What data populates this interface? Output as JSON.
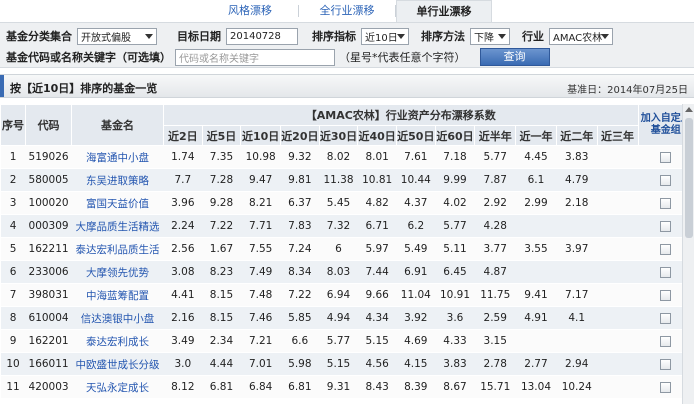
{
  "tabs": [
    {
      "label": "风格漂移",
      "active": false
    },
    {
      "label": "全行业漂移",
      "active": false
    },
    {
      "label": "单行业漂移",
      "active": true
    }
  ],
  "filter": {
    "category_label": "基金分类集合",
    "category_value": "开放式偏股",
    "date_label": "目标日期",
    "date_value": "20140728",
    "sort_metric_label": "排序指标",
    "sort_metric_value": "近10日",
    "sort_method_label": "排序方法",
    "sort_method_value": "下降",
    "industry_label": "行业",
    "industry_value": "AMAC农林",
    "keyword_label": "基金代码或名称关键字（可选填）",
    "keyword_placeholder": "代码或名称关键字",
    "hint": "（星号*代表任意个字符）",
    "query_button": "查询"
  },
  "section": {
    "title": "按【近10日】排序的基金一览",
    "base_date": "基准日：2014年07月25日"
  },
  "table": {
    "header_seq": "序号",
    "header_code": "代码",
    "header_name": "基金名",
    "header_group": "【AMAC农林】行业资产分布漂移系数",
    "header_add": "加入自定义基金组",
    "periods": [
      "近2日",
      "近5日",
      "近10日",
      "近20日",
      "近30日",
      "近40日",
      "近50日",
      "近60日",
      "近半年",
      "近一年",
      "近二年",
      "近三年"
    ],
    "rows": [
      {
        "seq": "1",
        "code": "519026",
        "name": "海富通中小盘",
        "v": [
          "1.74",
          "7.35",
          "10.98",
          "9.32",
          "8.02",
          "8.01",
          "7.61",
          "7.18",
          "5.77",
          "4.45",
          "3.83",
          ""
        ]
      },
      {
        "seq": "2",
        "code": "580005",
        "name": "东吴进取策略",
        "v": [
          "7.7",
          "7.28",
          "9.47",
          "9.81",
          "11.38",
          "10.81",
          "10.44",
          "9.99",
          "7.87",
          "6.1",
          "4.79",
          ""
        ]
      },
      {
        "seq": "3",
        "code": "100020",
        "name": "富国天益价值",
        "v": [
          "3.96",
          "9.28",
          "8.21",
          "6.37",
          "5.45",
          "4.82",
          "4.37",
          "4.02",
          "2.92",
          "2.99",
          "2.18",
          ""
        ]
      },
      {
        "seq": "4",
        "code": "000309",
        "name": "大摩品质生活精选",
        "v": [
          "2.24",
          "7.22",
          "7.71",
          "7.83",
          "7.32",
          "6.71",
          "6.2",
          "5.77",
          "4.28",
          "",
          "",
          ""
        ]
      },
      {
        "seq": "5",
        "code": "162211",
        "name": "泰达宏利品质生活",
        "v": [
          "2.56",
          "1.67",
          "7.55",
          "7.24",
          "6",
          "5.97",
          "5.49",
          "5.11",
          "3.77",
          "3.55",
          "3.97",
          ""
        ]
      },
      {
        "seq": "6",
        "code": "233006",
        "name": "大摩领先优势",
        "v": [
          "3.08",
          "8.23",
          "7.49",
          "8.34",
          "8.03",
          "7.44",
          "6.91",
          "6.45",
          "4.87",
          "",
          "",
          ""
        ]
      },
      {
        "seq": "7",
        "code": "398031",
        "name": "中海蓝筹配置",
        "v": [
          "4.41",
          "8.15",
          "7.48",
          "7.22",
          "6.94",
          "9.66",
          "11.04",
          "10.91",
          "11.75",
          "9.41",
          "7.17",
          ""
        ]
      },
      {
        "seq": "8",
        "code": "610004",
        "name": "信达澳银中小盘",
        "v": [
          "2.16",
          "8.15",
          "7.46",
          "5.85",
          "4.94",
          "4.34",
          "3.92",
          "3.6",
          "2.59",
          "4.91",
          "4.1",
          ""
        ]
      },
      {
        "seq": "9",
        "code": "162201",
        "name": "泰达宏利成长",
        "v": [
          "3.49",
          "2.34",
          "7.21",
          "6.6",
          "5.77",
          "5.15",
          "4.69",
          "4.33",
          "3.15",
          "",
          "",
          ""
        ]
      },
      {
        "seq": "10",
        "code": "166011",
        "name": "中欧盛世成长分级",
        "v": [
          "3.0",
          "4.44",
          "7.01",
          "5.98",
          "5.15",
          "4.56",
          "4.15",
          "3.83",
          "2.78",
          "2.77",
          "2.94",
          ""
        ]
      },
      {
        "seq": "11",
        "code": "420003",
        "name": "天弘永定成长",
        "v": [
          "8.12",
          "6.81",
          "6.84",
          "6.81",
          "9.31",
          "8.43",
          "8.39",
          "8.67",
          "15.71",
          "13.04",
          "10.24",
          ""
        ]
      }
    ]
  },
  "colors": {
    "accent": "#3a6bb3",
    "link": "#2456b0"
  }
}
